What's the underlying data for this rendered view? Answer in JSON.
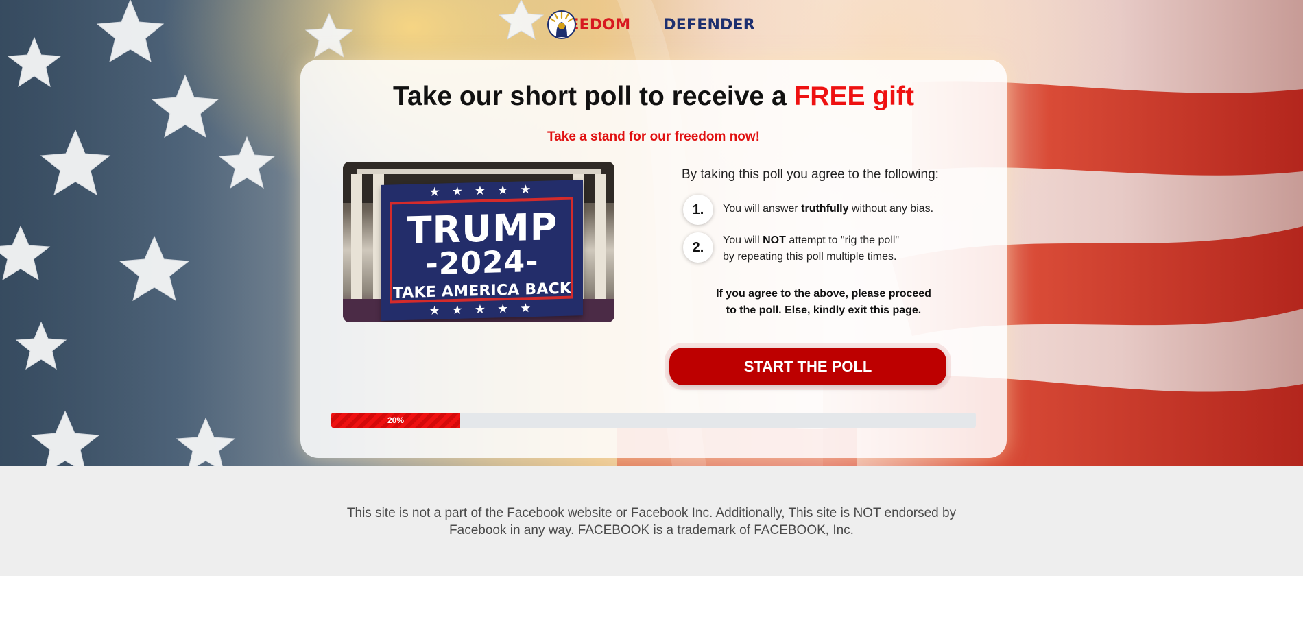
{
  "brand": {
    "word_left": "FREEDOM",
    "word_right": "DEFENDER",
    "colors": {
      "red": "#d71920",
      "blue": "#1d2f6f"
    }
  },
  "card": {
    "headline_prefix": "Take our short poll to receive a ",
    "headline_highlight": "FREE gift",
    "subhead": "Take a stand for our freedom now!",
    "image": {
      "stars": "★ ★ ★ ★ ★",
      "line1": "TRUMP",
      "line2": "-2024-",
      "line3": "TAKE AMERICA BACK"
    },
    "terms_intro": "By taking this poll you agree to the following:",
    "terms": [
      {
        "number": "1.",
        "before": "You will answer ",
        "bold": "truthfully",
        "after": " without any bias."
      },
      {
        "number": "2.",
        "before": "You will ",
        "bold": "NOT",
        "after": " attempt to \"rig the poll\"",
        "line2": "by repeating this poll multiple times."
      }
    ],
    "agree_note_line1": "If you agree to the above, please proceed",
    "agree_note_line2": "to the poll. Else, kindly exit this page.",
    "start_button": "START THE POLL",
    "progress": {
      "label": "20%",
      "percent": 20
    },
    "accent_red": "#bd0000"
  },
  "footer": {
    "line1": "This site is not a part of the Facebook website or Facebook Inc. Additionally, This site is NOT endorsed by",
    "line2": "Facebook in any way. FACEBOOK is a trademark of FACEBOOK, Inc."
  }
}
